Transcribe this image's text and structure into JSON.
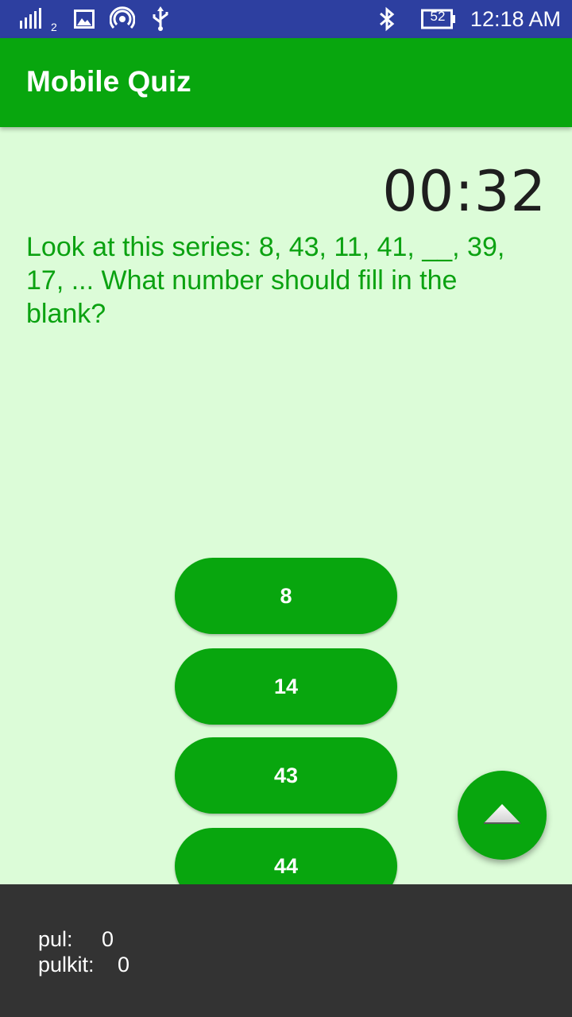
{
  "status_bar": {
    "signal_sub": "2",
    "battery": "52",
    "time": "12:18 AM",
    "icons": [
      "signal-icon",
      "image-icon",
      "hotspot-icon",
      "usb-icon",
      "bluetooth-icon",
      "battery-icon"
    ]
  },
  "app_bar": {
    "title": "Mobile Quiz"
  },
  "timer": "00:32",
  "question": "Look at this series: 8, 43, 11, 41, __, 39, 17, ... What number should fill in the blank?",
  "answers": [
    "8",
    "14",
    "43",
    "44"
  ],
  "fab": {
    "icon": "chevron-up-icon"
  },
  "scores": [
    {
      "name": "pul:",
      "value": "0"
    },
    {
      "name": "pulkit:",
      "value": "0"
    }
  ],
  "colors": {
    "primary": "#08a60e",
    "status_bar": "#2d3fa0",
    "background": "#dcfcd8",
    "bottom_panel": "#333333"
  }
}
